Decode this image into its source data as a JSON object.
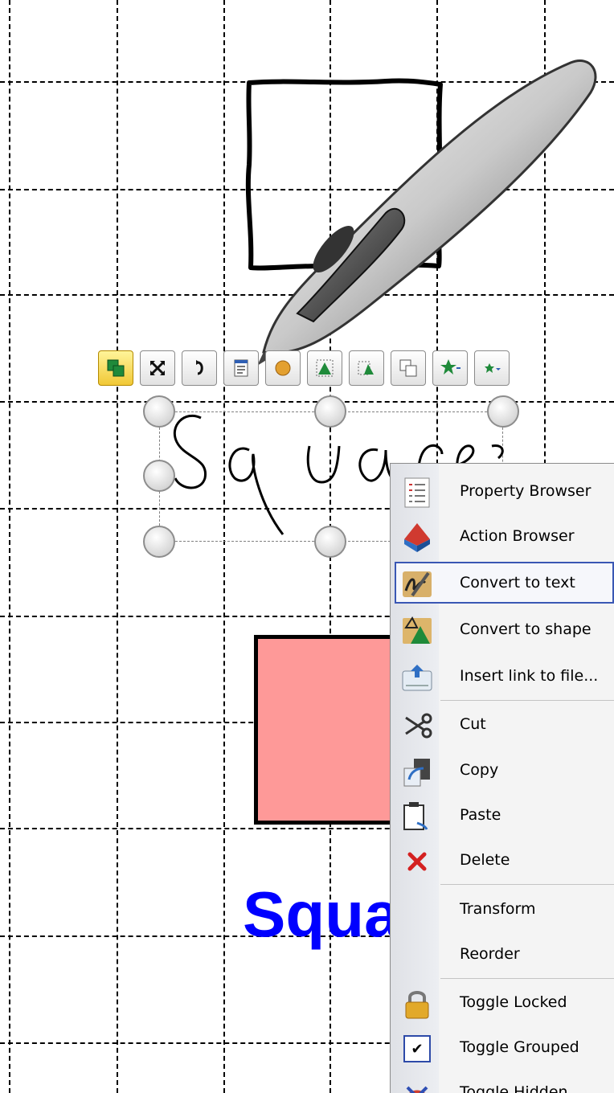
{
  "canvas": {
    "handwriting": "Square",
    "label": "Squa"
  },
  "toolbar": {
    "buttons": [
      {
        "icon": "group-icon",
        "active": true
      },
      {
        "icon": "resize-icon"
      },
      {
        "icon": "rotate-icon"
      },
      {
        "icon": "property-icon"
      },
      {
        "icon": "action-icon"
      },
      {
        "icon": "shape-recognize-icon"
      },
      {
        "icon": "align-icon"
      },
      {
        "icon": "reorder-icon"
      },
      {
        "icon": "favorite-icon"
      },
      {
        "icon": "favorite-menu-icon"
      }
    ]
  },
  "context_menu": {
    "items": [
      {
        "label": "Property Browser",
        "icon": "property-browser-icon"
      },
      {
        "label": "Action Browser",
        "icon": "action-browser-icon"
      },
      {
        "label": "Convert to text",
        "icon": "convert-text-icon",
        "highlighted": true
      },
      {
        "label": "Convert to shape",
        "icon": "convert-shape-icon"
      },
      {
        "label": "Insert link to file...",
        "icon": "insert-link-icon"
      },
      {
        "label": "Cut",
        "icon": "scissors-icon"
      },
      {
        "label": "Copy",
        "icon": "copy-icon"
      },
      {
        "label": "Paste",
        "icon": "paste-icon"
      },
      {
        "label": "Delete",
        "icon": "delete-icon"
      },
      {
        "label": "Transform",
        "icon": ""
      },
      {
        "label": "Reorder",
        "icon": ""
      },
      {
        "label": "Toggle Locked",
        "icon": "lock-icon"
      },
      {
        "label": "Toggle Grouped",
        "icon": "checkmark-icon",
        "checked": true
      },
      {
        "label": "Toggle Hidden",
        "icon": "hidden-icon"
      }
    ]
  },
  "colors": {
    "rect_fill": "#fe9998",
    "label_text": "#0000ff",
    "menu_highlight_border": "#3a57b4"
  }
}
